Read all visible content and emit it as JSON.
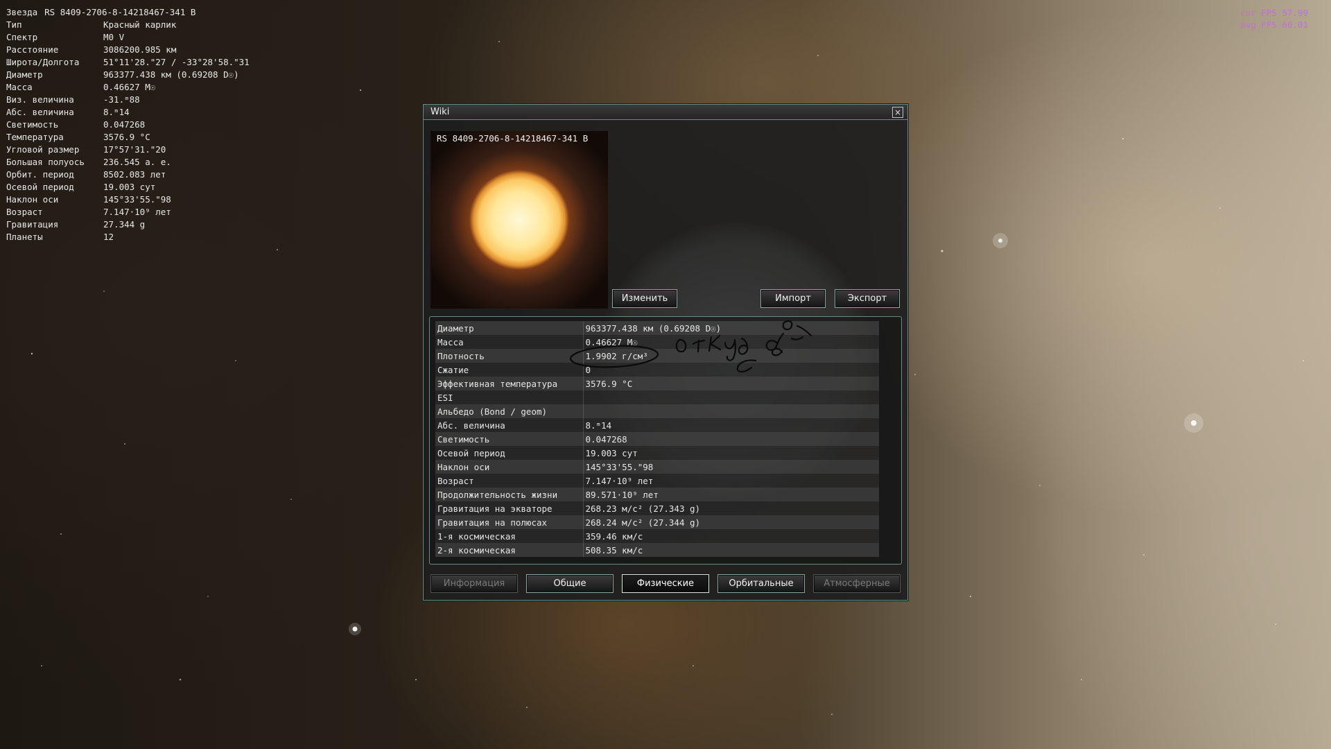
{
  "hud": {
    "star_label": "Звезда",
    "star_name": "RS 8409-2706-8-14218467-341 B",
    "rows": [
      {
        "k": "Тип",
        "v": "Красный карлик"
      },
      {
        "k": "Спектр",
        "v": "M0 V"
      },
      {
        "k": "Расстояние",
        "v": "3086200.985 км"
      },
      {
        "k": "Широта/Долгота",
        "v": "51°11'28.\"27 / -33°28'58.\"31"
      },
      {
        "k": "Диаметр",
        "v": "963377.438 км (0.69208 D☉)"
      },
      {
        "k": "Масса",
        "v": "0.46627 M☉"
      },
      {
        "k": "Виз. величина",
        "v": "-31.ᵐ88"
      },
      {
        "k": "Абс. величина",
        "v": "8.ᵐ14"
      },
      {
        "k": "Светимость",
        "v": "0.047268"
      },
      {
        "k": "Температура",
        "v": "3576.9 °C"
      },
      {
        "k": "Угловой размер",
        "v": "17°57'31.\"20"
      },
      {
        "k": "Большая полуось",
        "v": "236.545 а. е."
      },
      {
        "k": "Орбит. период",
        "v": "8502.083 лет"
      },
      {
        "k": "Осевой период",
        "v": "19.003 сут"
      },
      {
        "k": "Наклон оси",
        "v": "145°33'55.\"98"
      },
      {
        "k": "Возраст",
        "v": "7.147·10⁹ лет"
      },
      {
        "k": "Гравитация",
        "v": "27.344 g"
      },
      {
        "k": "Планеты",
        "v": "12"
      }
    ]
  },
  "fps": {
    "cur": "cur FPS 57.99",
    "avg": "avg FPS 60.01"
  },
  "wiki": {
    "title": "Wiki",
    "close": "×",
    "preview_name": "RS 8409-2706-8-14218467-341 B",
    "buttons": {
      "edit": "Изменить",
      "import": "Импорт",
      "export": "Экспорт"
    },
    "props": [
      {
        "k": "Диаметр",
        "v": "963377.438 км (0.69208 D☉)"
      },
      {
        "k": "Масса",
        "v": "0.46627 M☉"
      },
      {
        "k": "Плотность",
        "v": "1.9902 г/см³"
      },
      {
        "k": "Сжатие",
        "v": "0"
      },
      {
        "k": "Эффективная температура",
        "v": "3576.9 °C"
      },
      {
        "k": "ESI",
        "v": ""
      },
      {
        "k": "Альбедо (Bond / geom)",
        "v": ""
      },
      {
        "k": "Абс. величина",
        "v": "8.ᵐ14"
      },
      {
        "k": "Светимость",
        "v": "0.047268"
      },
      {
        "k": "Осевой период",
        "v": "19.003 сут"
      },
      {
        "k": "Наклон оси",
        "v": "145°33'55.\"98"
      },
      {
        "k": "Возраст",
        "v": "7.147·10⁹ лет"
      },
      {
        "k": "Продолжительность жизни",
        "v": "89.571·10⁹ лет"
      },
      {
        "k": "Гравитация на экваторе",
        "v": "268.23 м/с² (27.343 g)"
      },
      {
        "k": "Гравитация на полюсах",
        "v": "268.24 м/с² (27.344 g)"
      },
      {
        "k": "1-я космическая",
        "v": "359.46 км/с"
      },
      {
        "k": "2-я космическая",
        "v": "508.35 км/с"
      }
    ],
    "tabs": [
      {
        "label": "Информация",
        "state": "disabled"
      },
      {
        "label": "Общие",
        "state": "normal"
      },
      {
        "label": "Физические",
        "state": "active"
      },
      {
        "label": "Орбитальные",
        "state": "normal"
      },
      {
        "label": "Атмосферные",
        "state": "disabled"
      }
    ]
  },
  "annotation": {
    "handwritten_text": "откуда"
  }
}
